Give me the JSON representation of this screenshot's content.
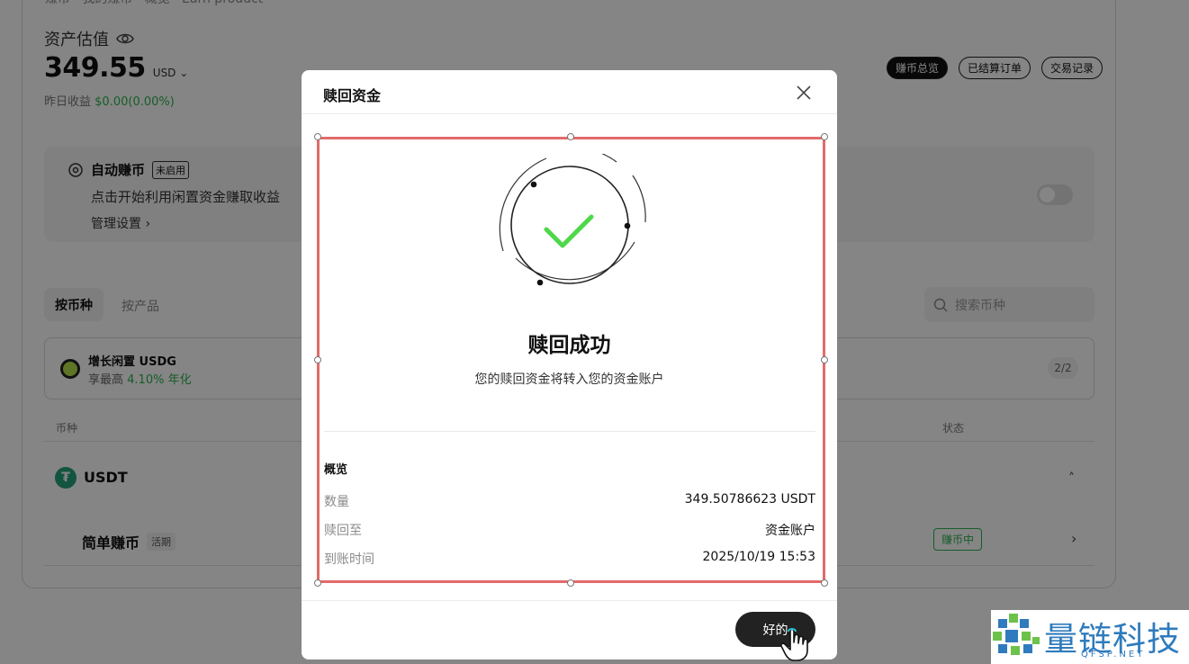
{
  "background": {
    "breadcrumb": "赚币 · 我的赚币 · 概览 · Earn product",
    "asset_label": "资产估值",
    "asset_value": "349.55",
    "asset_currency": "USD",
    "yesterday_label": "昨日收益",
    "yesterday_value": "$0.00(0.00%)",
    "pills": [
      "赚币总览",
      "已结算订单",
      "交易记录"
    ],
    "auto_earn": {
      "title": "自动赚币",
      "badge": "未启用",
      "description": "点击开始利用闲置资金赚取收益",
      "manage": "管理设置",
      "manage_chevron": "›"
    },
    "tabs": [
      "按币种",
      "按产品"
    ],
    "search_placeholder": "搜索币种",
    "promo": {
      "name": "增长闲置 USDG",
      "rate_prefix": "享最高",
      "rate_value": "4.10% 年化",
      "pages": "2/2"
    },
    "table": {
      "col_coin": "币种",
      "col_status": "状态"
    },
    "usdt": {
      "icon_glyph": "₮",
      "name": "USDT",
      "chevron": "˄",
      "product": "简单赚币",
      "product_tag": "活期",
      "status": "赚币中",
      "row_chevron": "›"
    }
  },
  "modal": {
    "title": "赎回资金",
    "success_title": "赎回成功",
    "success_desc": "您的赎回资金将转入您的资金账户",
    "overview_title": "概览",
    "rows": [
      {
        "label": "数量",
        "value": "349.50786623 USDT"
      },
      {
        "label": "赎回至",
        "value": "资金账户"
      },
      {
        "label": "到账时间",
        "value": "2025/10/19 15:53"
      }
    ],
    "ok_label": "好的"
  },
  "watermark": {
    "text": "量链科技",
    "sub": "QFSP.NET"
  },
  "colors": {
    "accent_green": "#2bb24c",
    "check_green": "#4fd84a",
    "selection_red": "#e36a6a",
    "watermark_blue": "#2f7bbd",
    "usdt_green": "#26a17b"
  }
}
